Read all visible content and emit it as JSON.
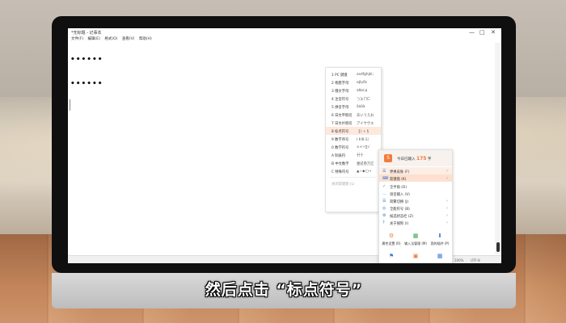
{
  "caption": "然后点击 “标点符号”",
  "window": {
    "title": "*无标题 - 记事本",
    "minimize_icon": "—",
    "maximize_icon": "□",
    "close_icon": "✕"
  },
  "menu": [
    "文件(F)",
    "编辑(E)",
    "格式(O)",
    "查看(V)",
    "帮助(H)"
  ],
  "editor": {
    "lines": [
      "••••••",
      "••••••"
    ]
  },
  "statusbar": {
    "position": "第1行, 第1列",
    "zoom": "100%",
    "encoding": "UTF-8"
  },
  "submenu": {
    "items": [
      {
        "label": "1 PC 键盘",
        "sample": "asdfghjkl;"
      },
      {
        "label": "2 希腊字母",
        "sample": "αβγδε"
      },
      {
        "label": "3 俄文字母",
        "sample": "абвгд"
      },
      {
        "label": "4 注音符号",
        "sample": "ㄅㄆㄇㄈ"
      },
      {
        "label": "5 拼音字母",
        "sample": "āáǎà"
      },
      {
        "label": "6 日文平假名",
        "sample": "あいうえお"
      },
      {
        "label": "7 日文片假名",
        "sample": "アイウヴエ"
      },
      {
        "label": "8 标点符号",
        "sample": "【（ ÷ §"
      },
      {
        "label": "9 数字序号",
        "sample": "Ⅰ Ⅱ Ⅲ ⑴"
      },
      {
        "label": "0 数学符号",
        "sample": "±×÷∑√"
      },
      {
        "label": "A 制表符",
        "sample": "┼┤┼"
      },
      {
        "label": "B 中文数字",
        "sample": "壹贰叁万亿"
      },
      {
        "label": "C 特殊符号",
        "sample": "▲☆◆□→"
      }
    ],
    "footer": "关闭软键盘 (L)"
  },
  "panel": {
    "logo": "S",
    "input_prefix": "今日已输入",
    "input_count": "175",
    "input_suffix": "字",
    "rows": [
      {
        "icon": "☰",
        "label": "更换皮肤 (F)"
      },
      {
        "icon": "⌨",
        "label": "软键盘 (K)"
      },
      {
        "icon": "✓",
        "label": "全半角 (O)"
      },
      {
        "icon": "…",
        "label": "语音输入 (V)"
      },
      {
        "icon": "☰",
        "label": "简繁切换 (J)"
      },
      {
        "icon": "◎",
        "label": "全能符号 (B)"
      },
      {
        "icon": "⚙",
        "label": "候选状态栏 (Z)"
      },
      {
        "icon": "?",
        "label": "关于搜狗 (I)"
      }
    ],
    "tools": [
      {
        "icon": "⚙",
        "label": "属性设置 (R)"
      },
      {
        "icon": "▦",
        "label": "输入法管理 (M)"
      },
      {
        "icon": "⬇",
        "label": "我的插件 (P)"
      }
    ],
    "bottom_icons": [
      "⚑",
      "▣",
      "▦"
    ],
    "colors": {
      "accent": "#f07b3a",
      "blue": "#3a7bd5",
      "highlight": "#fde0cf"
    }
  }
}
